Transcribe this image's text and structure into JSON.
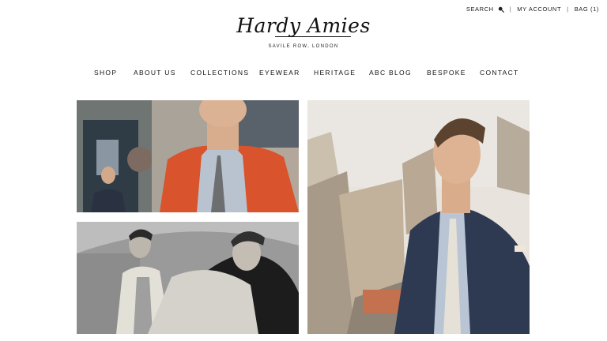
{
  "utility": {
    "search_label": "SEARCH",
    "search_icon": "search-icon",
    "account_label": "MY ACCOUNT",
    "bag_label": "BAG (1)",
    "separator": "|"
  },
  "brand": {
    "logo_text": "Hardy Amies",
    "tagline": "SAVILE ROW, LONDON"
  },
  "nav": {
    "items": [
      {
        "label": "SHOP"
      },
      {
        "label": "ABOUT US"
      },
      {
        "label": "COLLECTIONS"
      },
      {
        "label": "EYEWEAR"
      },
      {
        "label": "HERITAGE"
      },
      {
        "label": "ABC BLOG"
      },
      {
        "label": "BESPOKE"
      },
      {
        "label": "CONTACT"
      }
    ]
  },
  "colors": {
    "orange_coat": "#d9532c",
    "navy_suit": "#2e3a52",
    "street_beige": "#c9b9a4"
  }
}
